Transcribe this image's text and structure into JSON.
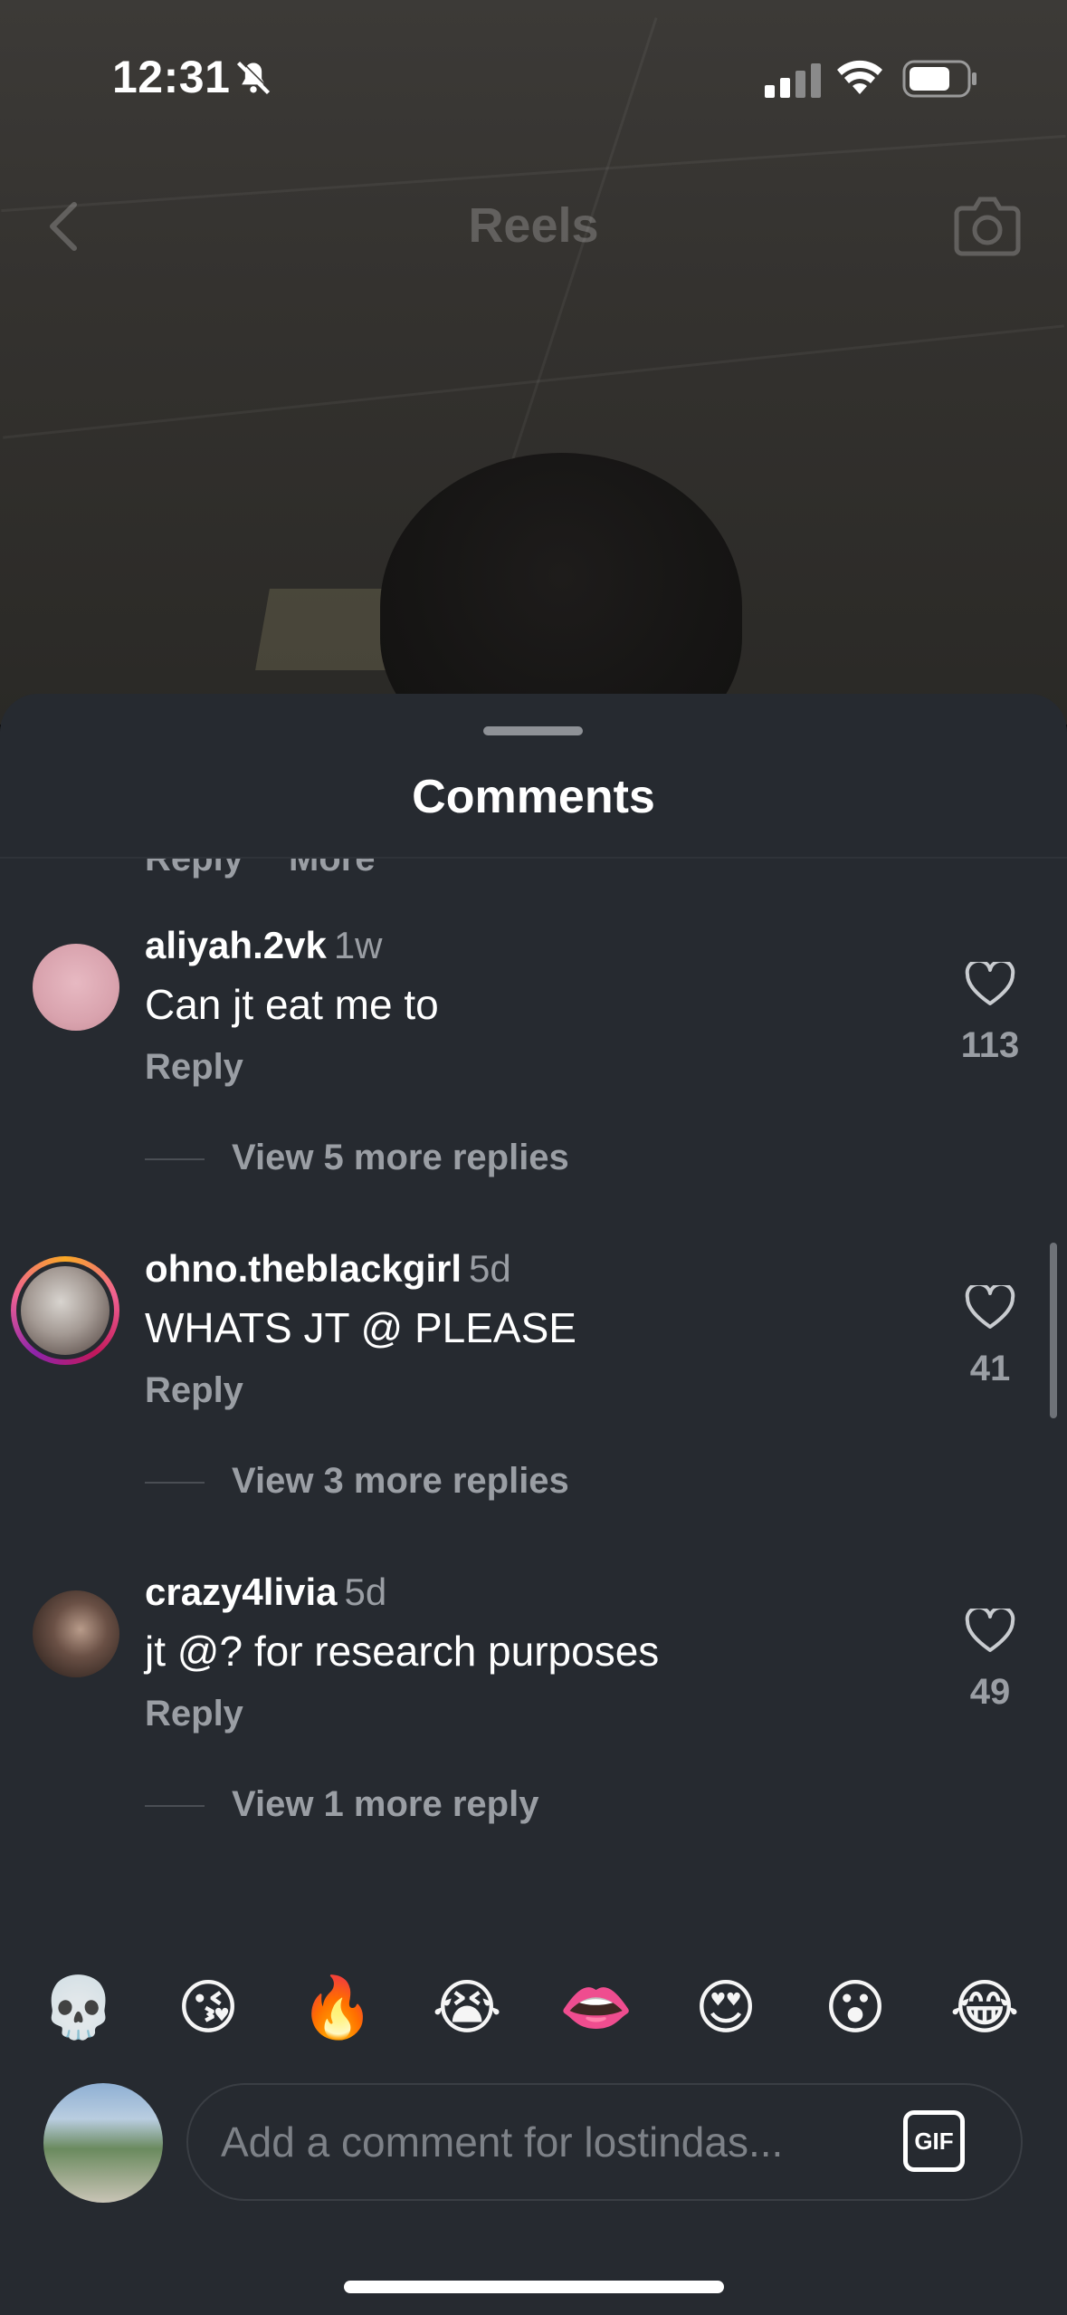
{
  "status_bar": {
    "time": "12:31"
  },
  "nav": {
    "title": "Reels"
  },
  "sheet": {
    "title": "Comments",
    "partial_top": {
      "reply": "Reply",
      "more": "More"
    }
  },
  "comments": [
    {
      "username": "aliyah.2vk",
      "time": "1w",
      "text": "Can jt eat me to",
      "reply_label": "Reply",
      "likes": "113",
      "view_replies": "View 5 more replies"
    },
    {
      "username": "ohno.theblackgirl",
      "time": "5d",
      "text": "WHATS JT @ PLEASE",
      "reply_label": "Reply",
      "likes": "41",
      "view_replies": "View 3 more replies"
    },
    {
      "username": "crazy4livia",
      "time": "5d",
      "text": "jt @? for research purposes",
      "reply_label": "Reply",
      "likes": "49",
      "view_replies": "View 1 more reply"
    }
  ],
  "partial_bottom": {
    "username": "crazy4livia",
    "time": "5d"
  },
  "emojis": [
    "💀",
    "😘",
    "🔥",
    "😭",
    "👄",
    "😍",
    "😮",
    "😂"
  ],
  "input": {
    "placeholder": "Add a comment for lostindas...",
    "gif_label": "GIF"
  },
  "colors": {
    "sheet_bg": "#262a30",
    "muted_text": "#9a9ea4",
    "text": "#ffffff"
  }
}
